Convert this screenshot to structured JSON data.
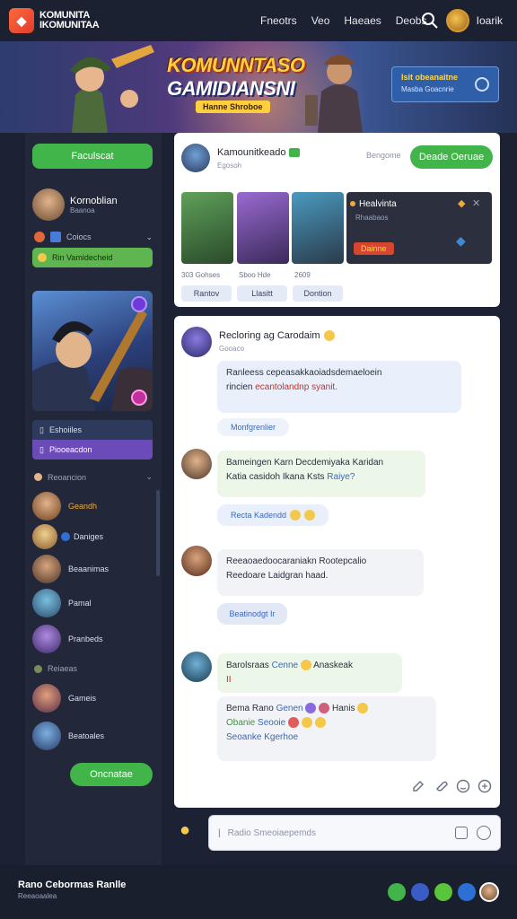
{
  "app": {
    "logo_line1": "KOMUNITA",
    "logo_line2": "IKOMUNITAA",
    "nav": [
      "Fneotrs",
      "Veo",
      "Haeaes",
      "Deobs"
    ],
    "user_label": "Ioarik"
  },
  "banner": {
    "title_line1": "KOMUNNTASO",
    "title_line2": "GAMIDIANSNI",
    "subtitle": "Hanne Shroboe",
    "promo_title": "Isit obeanaitne",
    "promo_sub": "Masba Goacnrie"
  },
  "sidebar": {
    "top_button": "Faculscat",
    "user": {
      "name": "Kornoblian",
      "sub": "Baanoa"
    },
    "row1": "Coiocs",
    "green_strip": "Rin Vamidecheid",
    "menu_a": "Eshoiiles",
    "menu_b": "Piooeacdon",
    "section1": "Reoancion",
    "section2": "Reiaeas",
    "friends": [
      "Geandh",
      "Daniges",
      "Beaanimas",
      "Pamal",
      "Pranbeds"
    ],
    "friends2": [
      "Gameis",
      "Beatoales"
    ],
    "bottom_button": "Oncnatae"
  },
  "post": {
    "author": "Kamounitkeado",
    "author_sub": "Egosoh",
    "meta": "Bengome",
    "follow_button": "Deade Oeruae",
    "info_title": "Healvinta",
    "info_sub": "Rhaabaos",
    "info_badge": "Dainne",
    "stats": [
      "303 Gohses",
      "Sboo Hde",
      "2609"
    ],
    "chips": [
      "Rantov",
      "Llasitt",
      "Dontion"
    ]
  },
  "chat": {
    "header_name": "Recloring ag Carodaim",
    "header_sub": "Gooaco",
    "messages": [
      {
        "line1": "Ranleess cepeasakkaoiadsdemaeloein",
        "line2": "rincien",
        "highlight": "ecantolandnp syanit.",
        "reply": "Monfgrenlier"
      },
      {
        "line1": "Bameingen Karn Decdemiyaka Karidan",
        "line2": "Katia casidoh Ikana Ksts",
        "highlight": "Raiye?",
        "reply": "Recta Kadendd"
      },
      {
        "line1": "Reeaoaedoocaraniakn Rootepcalio",
        "line2": "Reedoare Laidgran haad.",
        "highlight": "",
        "reply": "Beatinodgt Ir"
      },
      {
        "line1": "Barolsraas",
        "highlight": "Cenne",
        "line1b": "Anaskeak",
        "line2": "II"
      },
      {
        "line1": "Bema Rano",
        "highlight": "Genen",
        "line1b": "Hanis",
        "line2": "Obanie",
        "line2b": "Seooie",
        "line3": "Seoanke Kgerhoe"
      }
    ]
  },
  "composer": {
    "placeholder": "Radio Smeoiaepemds"
  },
  "footer": {
    "title": "Rano Cebormas Ranlle",
    "sub": "Reeaoaalea"
  },
  "colors": {
    "accent_green": "#41b54a",
    "accent_purple": "#6a4bb8",
    "link_blue": "#3b68b8",
    "highlight_red": "#c4302b"
  }
}
